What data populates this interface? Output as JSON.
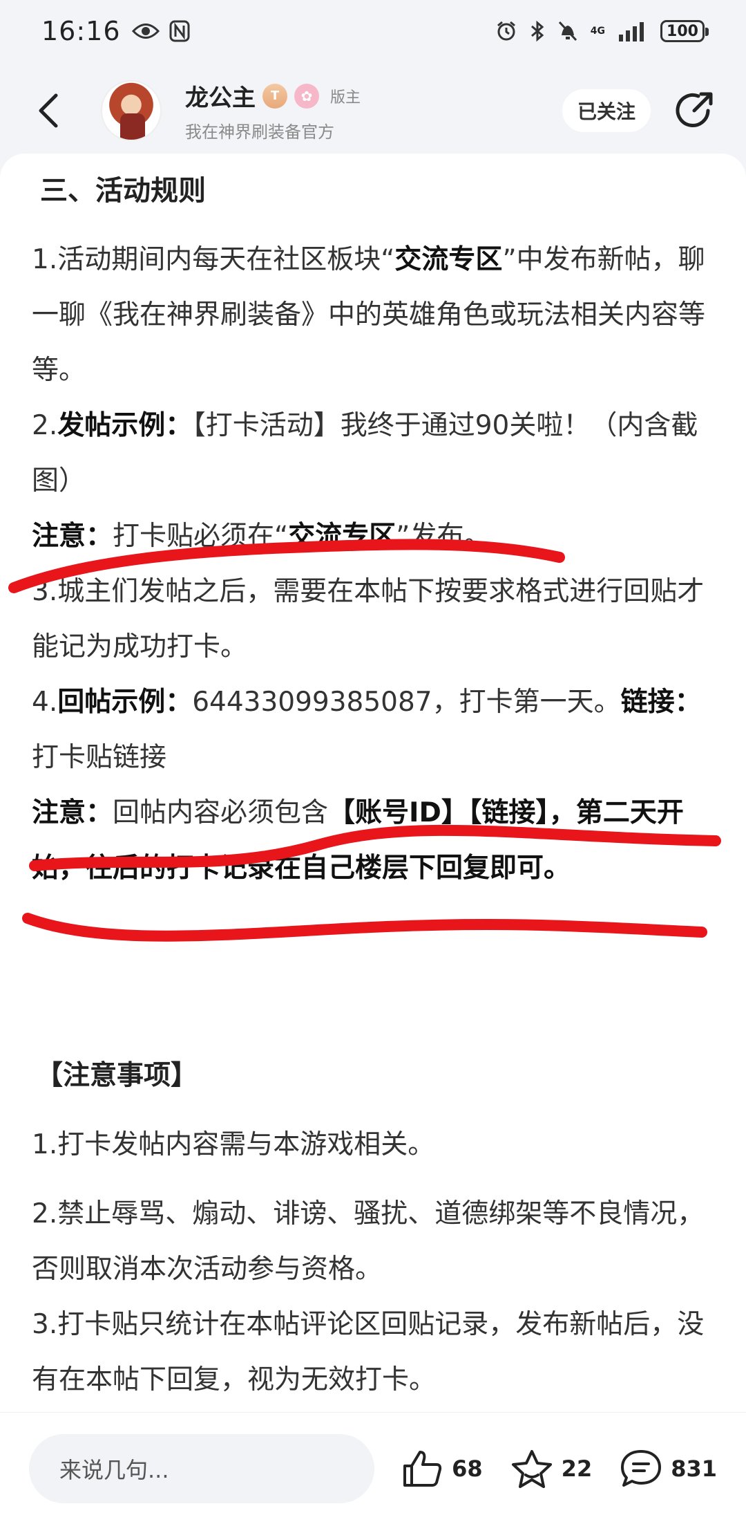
{
  "status_bar": {
    "time": "16:16",
    "network": "4G",
    "battery": "100"
  },
  "header": {
    "user_name": "龙公主",
    "badge_t": "T",
    "role": "版主",
    "subtitle": "我在神界刷装备官方",
    "follow_label": "已关注"
  },
  "post": {
    "section_title": "三、活动规则",
    "p1": [
      "1.活动期间内每天在社区板块“",
      "交流专区",
      "”中发布新帖，聊一聊《我在神界刷装备》中的英雄角色或玩法相关内容等等。"
    ],
    "p2": [
      "2.",
      "发帖示例：",
      "【打卡活动】我终于通过90关啦！（内含截图）"
    ],
    "note1": [
      "注意：",
      "打卡贴必须在“",
      "交流专区",
      "”发布。"
    ],
    "p3": "3.城主们发帖之后，需要在本帖下按要求格式进行回贴才能记为成功打卡。",
    "p4": [
      "4.",
      "回帖示例：",
      "64433099385087，打卡第一天。",
      "链接：",
      "打卡贴链接"
    ],
    "note2": [
      "注意：",
      "回帖内容必须包含",
      "【账号ID】【链接】，第二天开始，往后的打卡记录在自己楼层下回复即可。"
    ],
    "notice_title": "【注意事项】",
    "n1": "1.打卡发帖内容需与本游戏相关。",
    "n2": "2.禁止辱骂、煽动、诽谤、骚扰、道德绑架等不良情况，否则取消本次活动参与资格。",
    "n3": "3.打卡贴只统计在本帖评论区回贴记录，发布新帖后，没有在本帖下回复，视为无效打卡。"
  },
  "bottom_bar": {
    "comment_placeholder": "来说几句...",
    "likes": "68",
    "favorites": "22",
    "comments": "831"
  },
  "colors": {
    "markup_red": "#e8151b",
    "background": "#f3f4f8"
  },
  "icons": [
    "back-arrow-icon",
    "share-icon",
    "thumbs-up-icon",
    "star-icon",
    "comment-icon",
    "eye-icon",
    "nfc-icon",
    "alarm-icon",
    "bluetooth-icon",
    "mute-icon",
    "signal-icon",
    "battery-icon"
  ]
}
